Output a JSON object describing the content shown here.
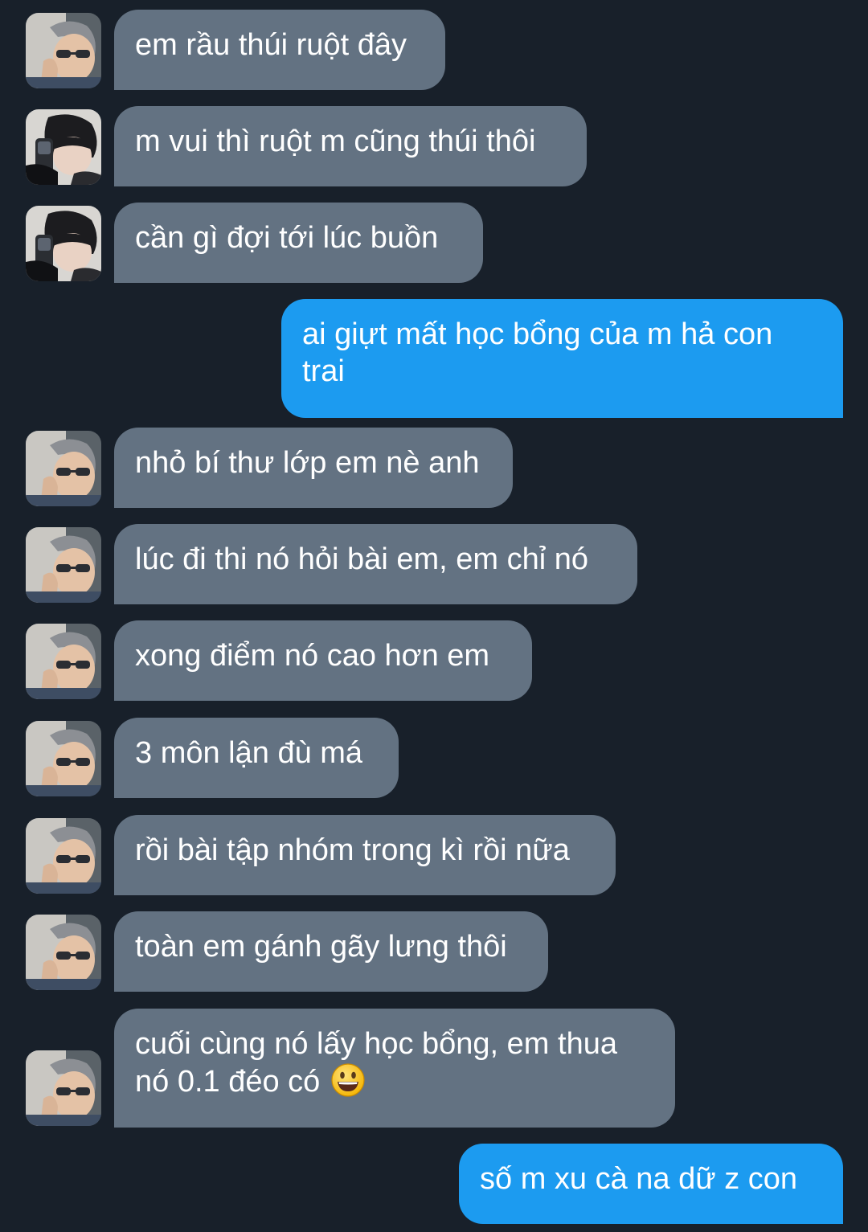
{
  "messages": [
    {
      "sender": "contact",
      "avatar": "contact-avatar-sunglasses",
      "text": "em rầu thúi ruột đây"
    },
    {
      "sender": "contact",
      "avatar": "contact-avatar-phone-selfie",
      "text": "m vui thì ruột m cũng thúi thôi"
    },
    {
      "sender": "contact",
      "avatar": "contact-avatar-phone-selfie",
      "text": "cần gì đợi tới lúc buồn"
    },
    {
      "sender": "me",
      "text": "ai giựt mất học bổng của m hả con trai"
    },
    {
      "sender": "contact",
      "avatar": "contact-avatar-sunglasses",
      "text": "nhỏ bí thư lớp em nè anh"
    },
    {
      "sender": "contact",
      "avatar": "contact-avatar-sunglasses",
      "text": "lúc đi thi nó hỏi bài em, em chỉ nó"
    },
    {
      "sender": "contact",
      "avatar": "contact-avatar-sunglasses",
      "text": "xong điểm nó cao hơn em"
    },
    {
      "sender": "contact",
      "avatar": "contact-avatar-sunglasses",
      "text": "3 môn lận đù má"
    },
    {
      "sender": "contact",
      "avatar": "contact-avatar-sunglasses",
      "text": "rồi bài tập nhóm trong kì rồi nữa"
    },
    {
      "sender": "contact",
      "avatar": "contact-avatar-sunglasses",
      "text": "toàn em gánh gãy lưng thôi"
    },
    {
      "sender": "contact",
      "avatar": "contact-avatar-sunglasses",
      "text": "cuối cùng nó lấy học bổng, em thua nó 0.1 đéo có",
      "emoji": "grinning-face-emoji"
    },
    {
      "sender": "me",
      "text": "số m xu cà na dữ z con"
    }
  ],
  "colors": {
    "background": "#18202a",
    "incoming_bubble": "#637282",
    "outgoing_bubble": "#1c9bf0",
    "text": "#ffffff"
  }
}
